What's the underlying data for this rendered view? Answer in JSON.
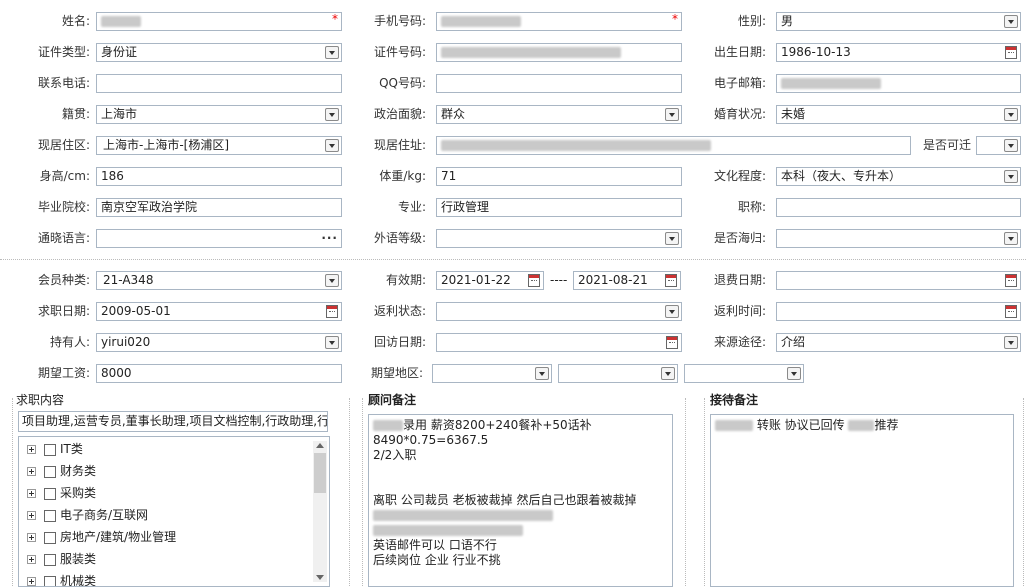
{
  "labels": {
    "name": "姓名:",
    "mobile": "手机号码:",
    "gender": "性别:",
    "id_type": "证件类型:",
    "id_no": "证件号码:",
    "birth": "出生日期:",
    "phone": "联系电话:",
    "qq": "QQ号码:",
    "email": "电子邮箱:",
    "native": "籍贯:",
    "political": "政治面貌:",
    "marital": "婚育状况:",
    "residence_area": "现居住区:",
    "address": "现居住址:",
    "relocate": "是否可迁",
    "height": "身高/cm:",
    "weight": "体重/kg:",
    "education": "文化程度:",
    "school": "毕业院校:",
    "major": "专业:",
    "title": "职称:",
    "language": "通晓语言:",
    "foreign_level": "外语等级:",
    "overseas": "是否海归:",
    "member_type": "会员种类:",
    "validity": "有效期:",
    "refund_date": "退费日期:",
    "job_date": "求职日期:",
    "rebate_status": "返利状态:",
    "rebate_time": "返利时间:",
    "holder": "持有人:",
    "visit_date": "回访日期:",
    "source": "来源途径:",
    "salary": "期望工资:",
    "region": "期望地区:"
  },
  "values": {
    "gender": "男",
    "id_type": "身份证",
    "birth": "1986-10-13",
    "native": "上海市",
    "political": "群众",
    "marital": "未婚",
    "residence_area": "上海市-上海市-[杨浦区]",
    "height": "186",
    "weight": "71",
    "education": "本科（夜大、专升本）",
    "school": "南京空军政治学院",
    "major": "行政管理",
    "member_type": "21-A348",
    "validity_from": "2021-01-22",
    "validity_sep": "----",
    "validity_to": "2021-08-21",
    "job_date": "2009-05-01",
    "holder": "yirui020",
    "source": "介绍",
    "salary": "8000"
  },
  "required_mark": "*",
  "job_panel": {
    "title": "求职内容",
    "summary": "项目助理,运营专员,董事长助理,项目文档控制,行政助理,行",
    "categories": [
      "IT类",
      "财务类",
      "采购类",
      "电子商务/互联网",
      "房地产/建筑/物业管理",
      "服装类",
      "机械类"
    ]
  },
  "advisor_panel": {
    "title": "顾问备注",
    "lines": [
      "录用  薪资8200+240餐补+50话补",
      "8490*0.75=6367.5",
      "2/2入职",
      "",
      "",
      "离职  公司裁员  老板被裁掉  然后自己也跟着被裁掉",
      "",
      "",
      "英语邮件可以    口语不行",
      "后续岗位  企业  行业不挑"
    ]
  },
  "reception_panel": {
    "title": "接待备注",
    "text_a": "转账  协议已回传",
    "text_b": "推荐"
  }
}
